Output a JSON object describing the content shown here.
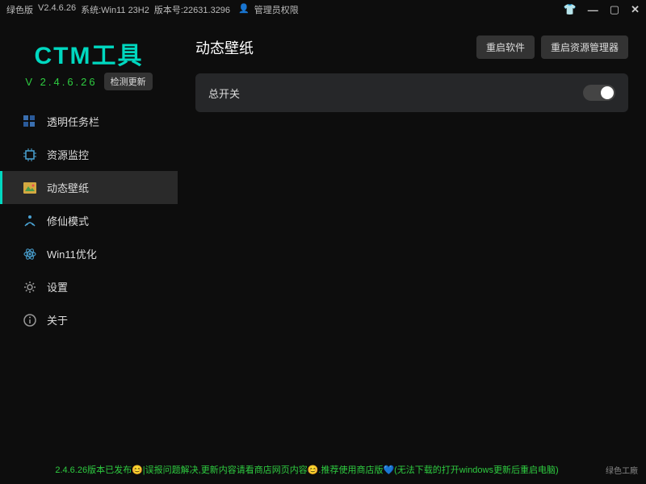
{
  "titlebar": {
    "edition": "绿色版",
    "version": "V2.4.6.26",
    "system": "系统:Win11 23H2",
    "build": "版本号:22631.3296",
    "admin": "管理员权限"
  },
  "logo": {
    "text": "CTM工具",
    "version": "V 2.4.6.26",
    "check_update": "检测更新"
  },
  "nav": {
    "items": [
      {
        "label": "透明任务栏"
      },
      {
        "label": "资源监控"
      },
      {
        "label": "动态壁纸"
      },
      {
        "label": "修仙模式"
      },
      {
        "label": "Win11优化"
      },
      {
        "label": "设置"
      },
      {
        "label": "关于"
      }
    ]
  },
  "main": {
    "title": "动态壁纸",
    "btn_restart_soft": "重启软件",
    "btn_restart_explorer": "重启资源管理器",
    "master_switch_label": "总开关"
  },
  "footer": {
    "message": "2.4.6.26版本已发布😊|误报问题解决,更新内容请看商店网页内容😊.推荐使用商店版💙(无法下载的打开windows更新后重启电脑)",
    "brand": "绿色工廠"
  }
}
